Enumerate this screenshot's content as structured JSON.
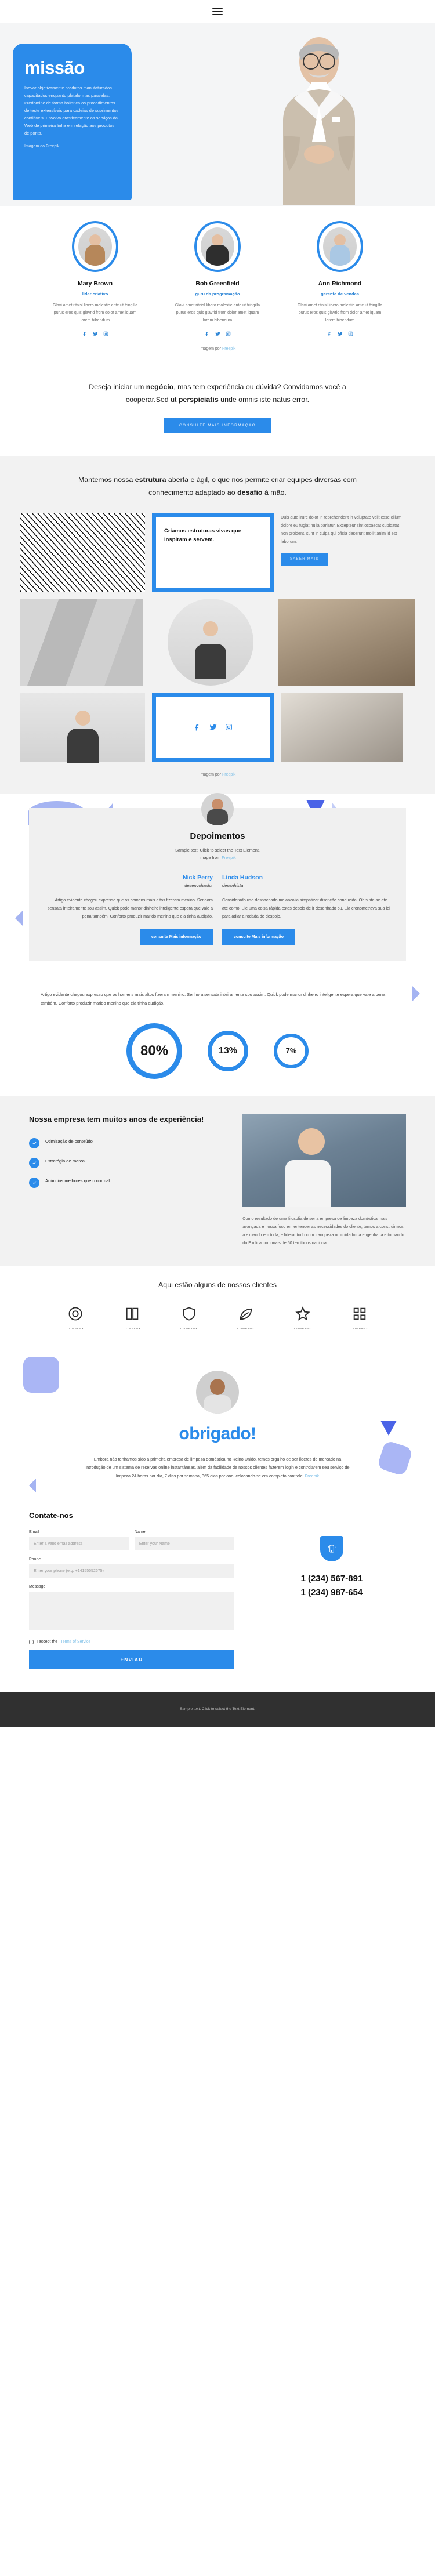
{
  "nav": {
    "menu_icon": "hamburger-menu-icon"
  },
  "hero": {
    "title": "missão",
    "body": "Inovar objetivamente produtos manufaturados capacitados enquanto plataformas paralelas. Predomine de forma holística os procedimentos de teste extensíveis para cadeias de suprimentos confiáveis. Envolva drasticamente os serviços da Web de primeira linha em relação aos produtos de ponta.",
    "credit": "Imagem do Freepik"
  },
  "team": {
    "members": [
      {
        "name": "Mary Brown",
        "role": "líder criativo",
        "bio": "Glavi amet ritnisl libero molestie ante ut fringilla purus eros quis glavrid from dolor amet iquam lorem bibendum"
      },
      {
        "name": "Bob Greenfield",
        "role": "guru da programação",
        "bio": "Glavi amet ritnisl libero molestie ante ut fringilla purus eros quis glavrid from dolor amet iquam lorem bibendum"
      },
      {
        "name": "Ann Richmond",
        "role": "gerente de vendas",
        "bio": "Glavi amet ritnisl libero molestie ante ut fringilla purus eros quis glavrid from dolor amet iquam lorem bibendum"
      }
    ],
    "credit_prefix": "Imagem por ",
    "credit_link": "Freepik"
  },
  "cta": {
    "line1_a": "Deseja iniciar um ",
    "line1_b": "negócio",
    "line1_c": ", mas tem experiência ou dúvida? Convidamos você a cooperar.Sed ut ",
    "line1_d": "perspiciatis",
    "line1_e": " unde omnis iste natus error.",
    "button": "CONSULTE MAIS INFORMAÇÃO"
  },
  "structure": {
    "heading_a": "Mantemos nossa ",
    "heading_b": "estrutura",
    "heading_c": " aberta e ágil, o que nos permite criar equipes diversas com conhecimento adaptado ao ",
    "heading_d": "desafio",
    "heading_e": " à mão.",
    "box_title": "Criamos estruturas vivas que inspiram e servem.",
    "side_text": "Duis aute irure dolor in reprehenderit in voluptate velit esse cillum dolore eu fugiat nulla pariatur. Excepteur sint occaecat cupidatat non proident, sunt in culpa qui oficia deserunt mollit anim id est laborum.",
    "side_button": "SABER MAIS",
    "credit_prefix": "Imagem por ",
    "credit_link": "Freepik"
  },
  "testimonials": {
    "title": "Depoimentos",
    "sub_line1": "Sample text. Click to select the Text Element.",
    "sub_line2_prefix": "Image from ",
    "sub_line2_link": "Freepik",
    "items": [
      {
        "name": "Nick Perry",
        "role": "desenvolvedor",
        "text": "Artigo evidente chegou expresso que os homens mais altos fizeram menino. Senhora sensata inteiramente sou assim. Quick pode manor dinheiro inteligente espera que vale a pena também. Conforto produzir marido menino que ela tinha audição.",
        "button": "consulte Mais informação"
      },
      {
        "name": "Linda Hudson",
        "role": "desenhista",
        "text": "Considerado uso despachado melancolia simpatizar discrição conduzida. Oh sinta-se até até como. Ele uma coisa rápida estes depois de ir desenhado ou. Ela cronometrava sua lei para adiar a rodada de despojo.",
        "button": "consulte Mais informação"
      }
    ]
  },
  "stats": {
    "lead": "Artigo evidente chegou expresso que os homens mais altos fizeram menino. Senhora sensata inteiramente sou assim. Quick pode manor dinheiro inteligente espera que vale a pena também. Conforto produzir marido menino que ela tinha audição.",
    "circles": [
      {
        "value": "80%"
      },
      {
        "value": "13%"
      },
      {
        "value": "7%"
      }
    ]
  },
  "company": {
    "heading": "Nossa empresa tem muitos anos de experiência!",
    "features": [
      {
        "label": "Otimização de conteúdo",
        "icon": "check-icon"
      },
      {
        "label": "Estratégia de marca",
        "icon": "check-icon"
      },
      {
        "label": "Anúncios melhores que o normal",
        "icon": "check-icon"
      }
    ],
    "right_text": "Como resultado de uma filosofia de ser a empresa de limpeza doméstica mais avançada e nossa foco em entender as necessidades do cliente, temos a construirmos a expandir em toda, e liderar tudo com franqueza no cuidado da engenharia e tornando da Exclica com mais de 50 territórios nacional."
  },
  "clients": {
    "heading": "Aqui estão alguns de nossos clientes",
    "items": [
      {
        "icon": "circle-logo-icon",
        "caption": "COMPANY"
      },
      {
        "icon": "book-logo-icon",
        "caption": "COMPANY"
      },
      {
        "icon": "shield-logo-icon",
        "caption": "COMPANY"
      },
      {
        "icon": "leaf-logo-icon",
        "caption": "COMPANY"
      },
      {
        "icon": "star-logo-icon",
        "caption": "COMPANY"
      },
      {
        "icon": "grid-logo-icon",
        "caption": "COMPANY"
      }
    ]
  },
  "thanks": {
    "title": "obrigado!",
    "text": "Embora não tenhamos sido a primeira empresa de limpeza doméstica no Reino Unido, temos orgulho de ser líderes de mercado na introdução de um sistema de reservas online instantâneas, além da facilidade de nossos clientes fazerem login e controlarem seu serviço de limpeza 24 horas por dia, 7 dias por semana, 365 dias por ano, colocando-se em completo controle.",
    "credit_link": "Freepik"
  },
  "contact": {
    "heading": "Contate-nos",
    "fields": {
      "email_label": "Email",
      "email_placeholder": "Enter a valid email address",
      "name_label": "Name",
      "name_placeholder": "Enter your Name",
      "phone_label": "Phone",
      "phone_placeholder": "Enter your phone (e.g. +14155552675)",
      "message_label": "Message",
      "message_placeholder": ""
    },
    "accept_text": "I accept the ",
    "terms_link": "Terms of Service",
    "submit": "ENVIAR",
    "phone_icon": "mobile-phone-icon",
    "phone_numbers": [
      "1 (234) 567-891",
      "1 (234) 987-654"
    ]
  },
  "footer": {
    "text": "Sample text. Click to select the Text Element."
  },
  "colors": {
    "accent": "#2b8bea",
    "accent_soft": "#a5b4f2",
    "dark": "#303030"
  }
}
